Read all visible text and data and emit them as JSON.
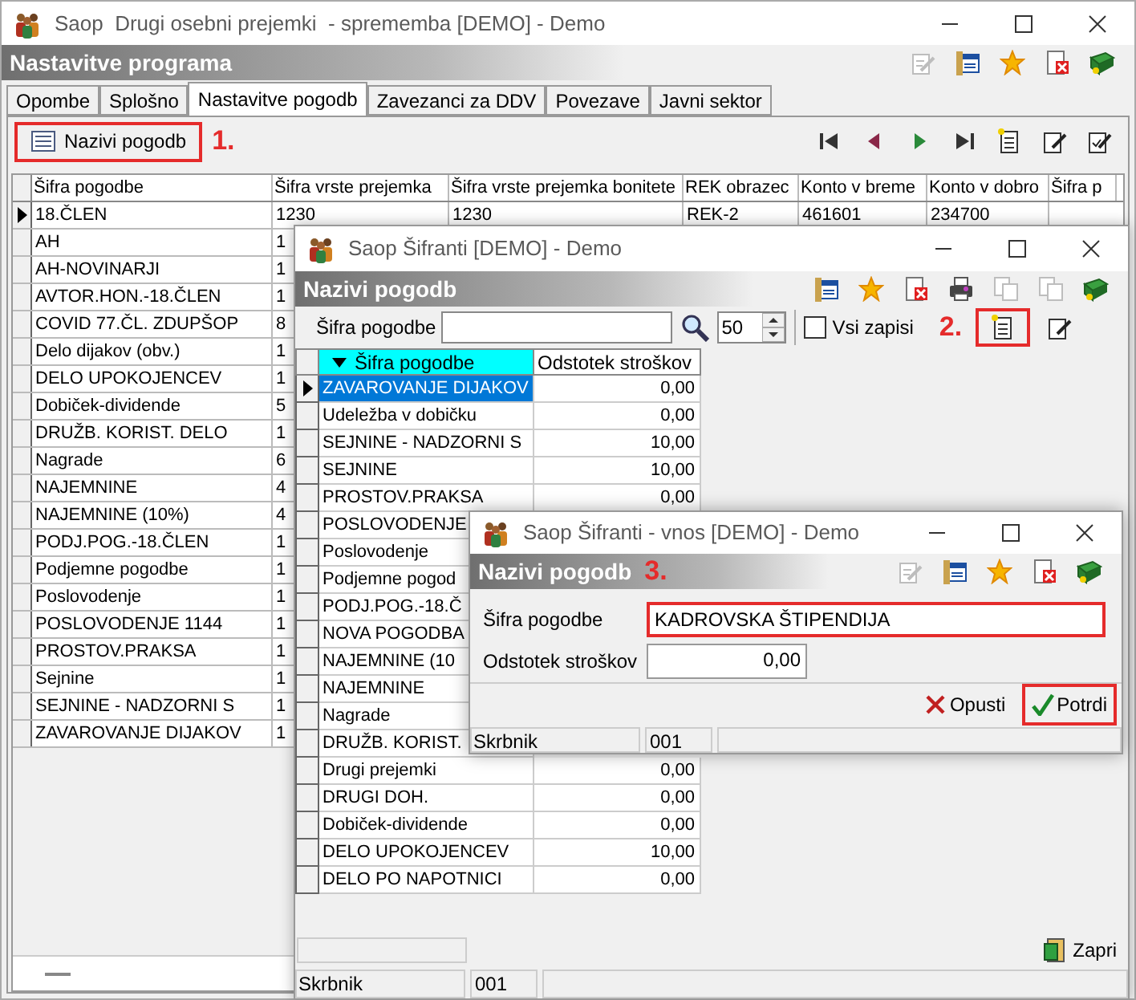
{
  "main_window": {
    "title": "Saop  Drugi osebni prejemki  - sprememba [DEMO] - Demo",
    "header": "Nastavitve programa",
    "header_tools": [
      {
        "kind": "edit",
        "disabled": true
      },
      {
        "kind": "window",
        "disabled": false
      },
      {
        "kind": "star",
        "disabled": false
      },
      {
        "kind": "delete",
        "disabled": false
      },
      {
        "kind": "help",
        "disabled": false
      }
    ],
    "tabs": [
      {
        "label": "Opombe",
        "selected": false
      },
      {
        "label": "Splošno",
        "selected": false
      },
      {
        "label": "Nastavitve pogodb",
        "selected": true
      },
      {
        "label": "Zavezanci za DDV",
        "selected": false
      },
      {
        "label": "Povezave",
        "selected": false
      },
      {
        "label": "Javni sektor",
        "selected": false
      }
    ],
    "toolbar_button": {
      "label": "Nazivi pogodb",
      "highlighted": true
    },
    "step": "1.",
    "table": {
      "columns": [
        "Šifra pogodbe",
        "Šifra vrste prejemka",
        "Šifra vrste prejemka bonitete",
        "REK obrazec",
        "Konto v breme",
        "Konto v dobro",
        "Šifra p"
      ],
      "rows": [
        {
          "cells": [
            "18.ČLEN",
            "1230",
            "1230",
            "REK-2",
            "461601",
            "234700"
          ],
          "selected": true
        },
        {
          "cells": [
            "AH",
            "1"
          ],
          "selected": false
        },
        {
          "cells": [
            "AH-NOVINARJI",
            "1"
          ],
          "selected": false
        },
        {
          "cells": [
            "AVTOR.HON.-18.ČLEN",
            "1"
          ],
          "selected": false
        },
        {
          "cells": [
            "COVID 77.ČL. ZDUPŠOP",
            "8"
          ],
          "selected": false
        },
        {
          "cells": [
            "Delo dijakov (obv.)",
            "1"
          ],
          "selected": false
        },
        {
          "cells": [
            "DELO UPOKOJENCEV",
            "1"
          ],
          "selected": false
        },
        {
          "cells": [
            "Dobiček-dividende",
            "5"
          ],
          "selected": false
        },
        {
          "cells": [
            "DRUŽB. KORIST. DELO",
            "1"
          ],
          "selected": false
        },
        {
          "cells": [
            "Nagrade",
            "6"
          ],
          "selected": false
        },
        {
          "cells": [
            "NAJEMNINE",
            "4"
          ],
          "selected": false
        },
        {
          "cells": [
            "NAJEMNINE (10%)",
            "4"
          ],
          "selected": false
        },
        {
          "cells": [
            "PODJ.POG.-18.ČLEN",
            "1"
          ],
          "selected": false
        },
        {
          "cells": [
            "Podjemne pogodbe",
            "1"
          ],
          "selected": false
        },
        {
          "cells": [
            "Poslovodenje",
            "1"
          ],
          "selected": false
        },
        {
          "cells": [
            "POSLOVODENJE 1144",
            "1"
          ],
          "selected": false
        },
        {
          "cells": [
            "PROSTOV.PRAKSA",
            "1"
          ],
          "selected": false
        },
        {
          "cells": [
            "Sejnine",
            "1"
          ],
          "selected": false
        },
        {
          "cells": [
            "SEJNINE - NADZORNI S",
            "1"
          ],
          "selected": false
        },
        {
          "cells": [
            "ZAVAROVANJE DIJAKOV",
            "1"
          ],
          "selected": false
        }
      ]
    }
  },
  "list_window": {
    "title": "Saop Šifranti [DEMO] - Demo",
    "header": "Nazivi pogodb",
    "header_tools": [
      {
        "kind": "window",
        "disabled": false
      },
      {
        "kind": "star",
        "disabled": false
      },
      {
        "kind": "delete",
        "disabled": false
      },
      {
        "kind": "printer",
        "disabled": false
      },
      {
        "kind": "copy",
        "disabled": true
      },
      {
        "kind": "copy",
        "disabled": true
      },
      {
        "kind": "help",
        "disabled": false
      }
    ],
    "filter": {
      "label": "Šifra pogodbe",
      "count": "50",
      "all_records": {
        "label": "Vsi zapisi",
        "checked": false
      }
    },
    "step": "2.",
    "new_button": {
      "highlighted": true
    },
    "table": {
      "columns": [
        {
          "label": "Šifra pogodbe",
          "sorted": true
        },
        {
          "label": "Odstotek stroškov",
          "sorted": false
        }
      ],
      "rows": [
        {
          "cells": [
            "ZAVAROVANJE DIJAKOV",
            "0,00"
          ],
          "selected": true
        },
        {
          "cells": [
            "Udeležba v dobičku",
            "0,00"
          ],
          "selected": false
        },
        {
          "cells": [
            "SEJNINE - NADZORNI S",
            "10,00"
          ],
          "selected": false
        },
        {
          "cells": [
            "SEJNINE",
            "10,00"
          ],
          "selected": false
        },
        {
          "cells": [
            "PROSTOV.PRAKSA",
            "0,00"
          ],
          "selected": false
        },
        {
          "cells": [
            "POSLOVODENJE"
          ],
          "selected": false
        },
        {
          "cells": [
            "Poslovodenje"
          ],
          "selected": false
        },
        {
          "cells": [
            "Podjemne pogod"
          ],
          "selected": false
        },
        {
          "cells": [
            "PODJ.POG.-18.Č"
          ],
          "selected": false
        },
        {
          "cells": [
            "NOVA POGODBA"
          ],
          "selected": false
        },
        {
          "cells": [
            "NAJEMNINE (10"
          ],
          "selected": false
        },
        {
          "cells": [
            "NAJEMNINE"
          ],
          "selected": false
        },
        {
          "cells": [
            "Nagrade"
          ],
          "selected": false
        },
        {
          "cells": [
            "DRUŽB. KORIST."
          ],
          "selected": false
        },
        {
          "cells": [
            "Drugi prejemki",
            "0,00"
          ],
          "selected": false
        },
        {
          "cells": [
            "DRUGI DOH.",
            "0,00"
          ],
          "selected": false
        },
        {
          "cells": [
            "Dobiček-dividende",
            "0,00"
          ],
          "selected": false
        },
        {
          "cells": [
            "DELO UPOKOJENCEV",
            "10,00"
          ],
          "selected": false
        },
        {
          "cells": [
            "DELO PO NAPOTNICI",
            "0,00"
          ],
          "selected": false
        }
      ]
    },
    "close_button": "Zapri",
    "status": [
      "Skrbnik",
      "001"
    ]
  },
  "entry_window": {
    "title": "Saop Šifranti - vnos [DEMO] - Demo",
    "header": "Nazivi pogodb",
    "step": "3.",
    "header_tools": [
      {
        "kind": "edit",
        "disabled": true
      },
      {
        "kind": "window",
        "disabled": false
      },
      {
        "kind": "star",
        "disabled": false
      },
      {
        "kind": "delete",
        "disabled": false
      },
      {
        "kind": "help",
        "disabled": false
      }
    ],
    "fields": [
      {
        "label": "Šifra pogodbe",
        "value": "KADROVSKA ŠTIPENDIJA",
        "highlighted": true
      },
      {
        "label": "Odstotek stroškov",
        "value": "0,00",
        "highlighted": false
      }
    ],
    "buttons": [
      {
        "kind": "cancel",
        "label": "Opusti",
        "highlighted": false
      },
      {
        "kind": "confirm",
        "label": "Potrdi",
        "highlighted": true
      }
    ],
    "status": [
      "Skrbnik",
      "001"
    ]
  }
}
